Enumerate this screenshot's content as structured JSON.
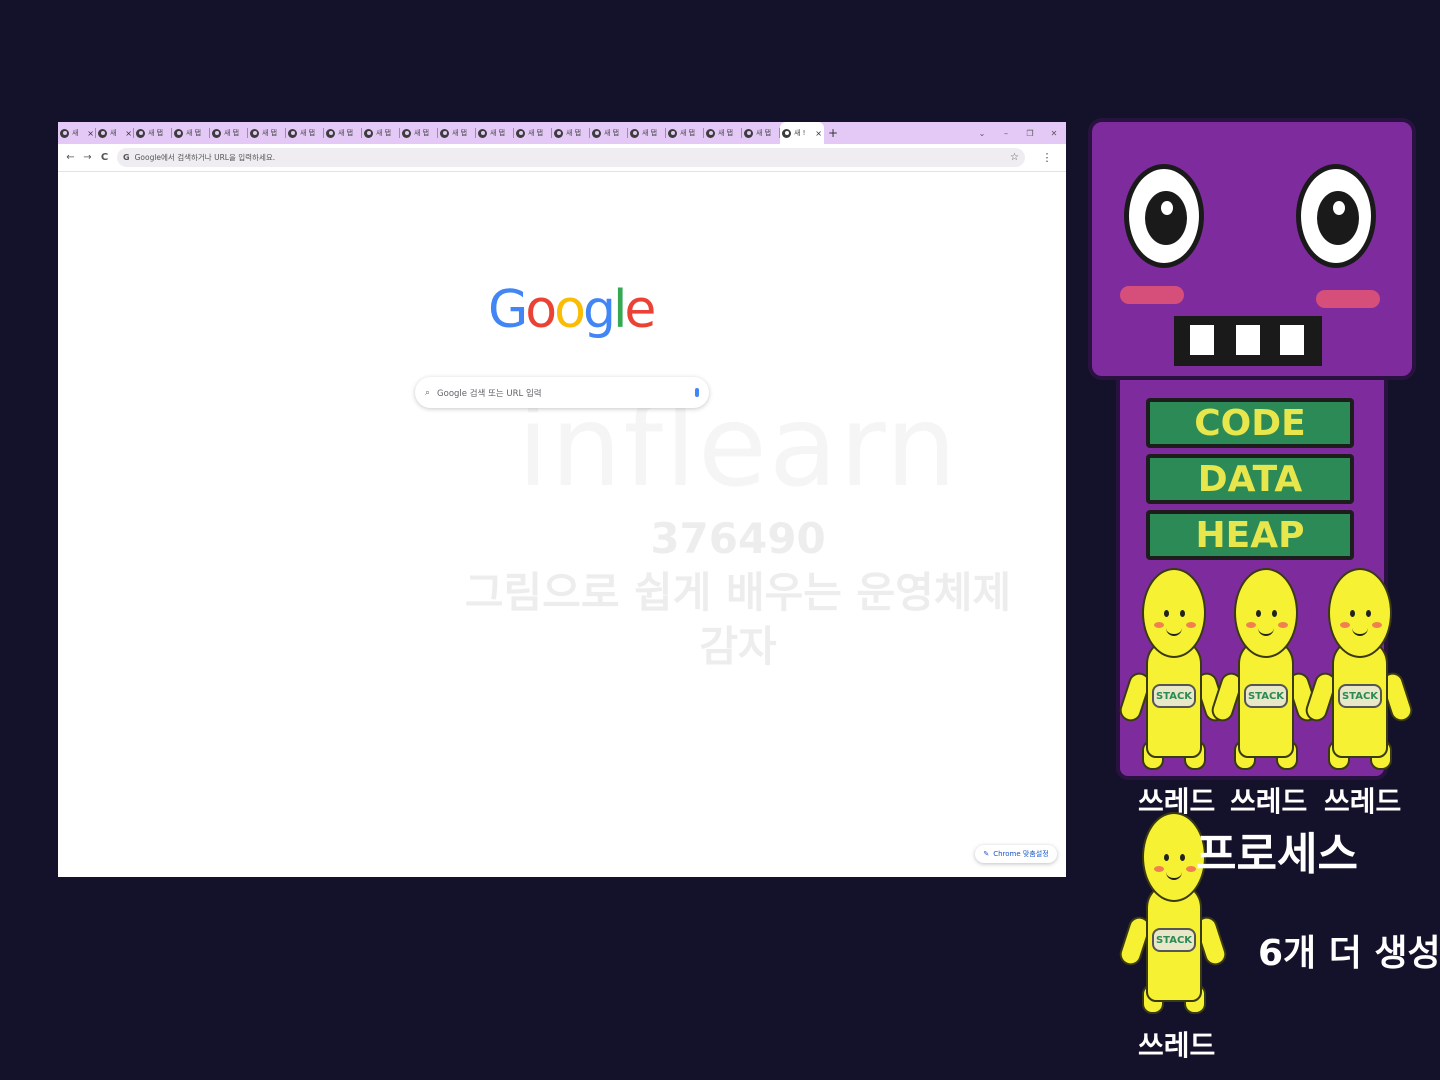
{
  "browser": {
    "tabs": [
      {
        "label": "새",
        "active": false
      },
      {
        "label": "새",
        "active": false
      },
      {
        "label": "새 탭",
        "active": false
      },
      {
        "label": "새 탭",
        "active": false
      },
      {
        "label": "새 탭",
        "active": false
      },
      {
        "label": "새 탭",
        "active": false
      },
      {
        "label": "새 탭",
        "active": false
      },
      {
        "label": "새 탭",
        "active": false
      },
      {
        "label": "새 탭",
        "active": false
      },
      {
        "label": "새 탭",
        "active": false
      },
      {
        "label": "새 탭",
        "active": false
      },
      {
        "label": "새 탭",
        "active": false
      },
      {
        "label": "새 탭",
        "active": false
      },
      {
        "label": "새 탭",
        "active": false
      },
      {
        "label": "새 탭",
        "active": false
      },
      {
        "label": "새 탭",
        "active": false
      },
      {
        "label": "새 탭",
        "active": false
      },
      {
        "label": "새 탭",
        "active": false
      },
      {
        "label": "새 탭",
        "active": false
      },
      {
        "label": "새 !",
        "active": true
      }
    ],
    "new_tab_glyph": "+",
    "window_controls": {
      "dropdown": "⌄",
      "minimize": "–",
      "restore": "❐",
      "close": "✕"
    },
    "close_glyph": "×",
    "nav": {
      "back": "←",
      "forward": "→",
      "reload": "C"
    },
    "omnibox": {
      "g_icon": "G",
      "placeholder": "Google에서 검색하거나 URL을 입력하세요.",
      "star": "☆"
    },
    "menu_glyph": "⋮",
    "google_logo": {
      "letters": [
        "G",
        "o",
        "o",
        "g",
        "l",
        "e"
      ],
      "colors": [
        "#4285f4",
        "#ea4335",
        "#fbbc05",
        "#4285f4",
        "#34a853",
        "#ea4335"
      ]
    },
    "search": {
      "icon": "🔍",
      "placeholder": "Google 검색 또는 URL 입력"
    },
    "customize": {
      "label": "Chrome 맞춤설정",
      "icon": "✎"
    }
  },
  "watermark": {
    "brand": "inflearn",
    "id": "376490",
    "course": "그림으로 쉽게 배우는 운영체제",
    "suffix": "감자"
  },
  "illustration": {
    "segments": [
      "CODE",
      "DATA",
      "HEAP"
    ],
    "stack_label": "STACK",
    "thread_label": "쓰레드",
    "process_label": "프로세스",
    "note": "6개 더 생성",
    "colors": {
      "robot": "#7e2b9e",
      "segment": "#2b8a55",
      "segment_text": "#e8e64d",
      "thread": "#f6f133",
      "background": "#13122a"
    }
  }
}
